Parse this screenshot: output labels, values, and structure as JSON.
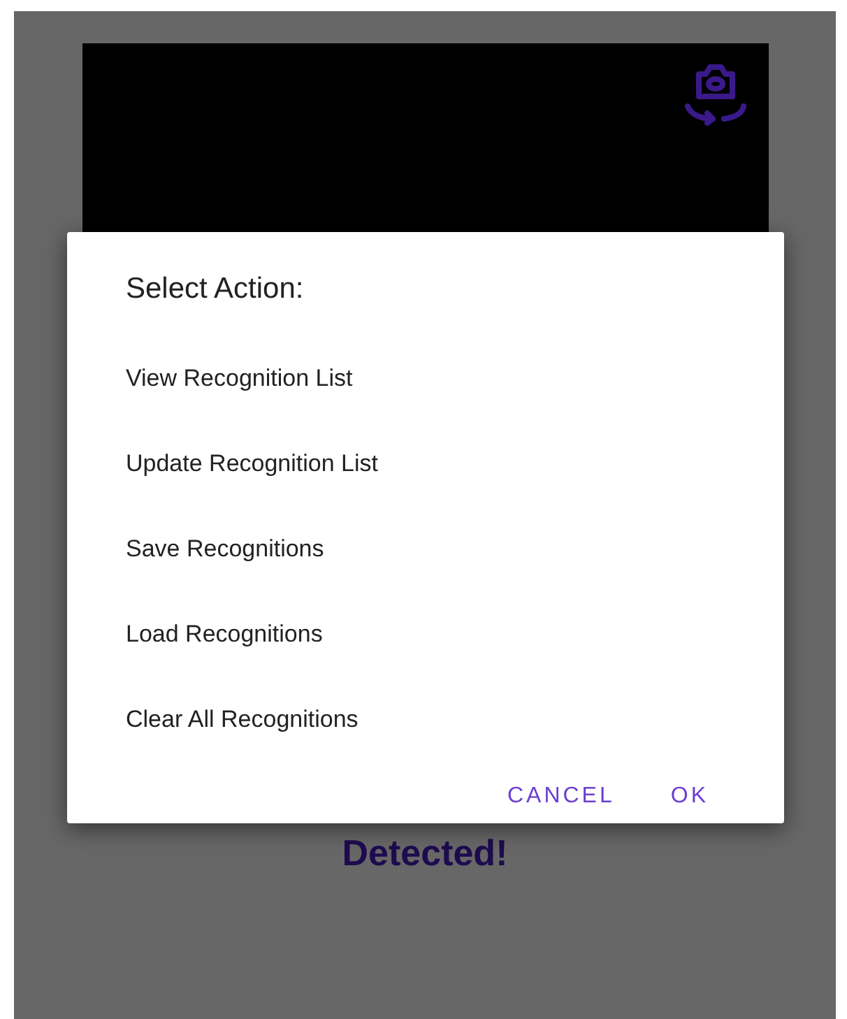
{
  "background": {
    "status_text": "Detected!"
  },
  "dialog": {
    "title": "Select Action:",
    "options": [
      "View Recognition List",
      "Update Recognition List",
      "Save Recognitions",
      "Load Recognitions",
      "Clear All Recognitions"
    ],
    "buttons": [
      "CANCEL",
      "OK"
    ]
  }
}
